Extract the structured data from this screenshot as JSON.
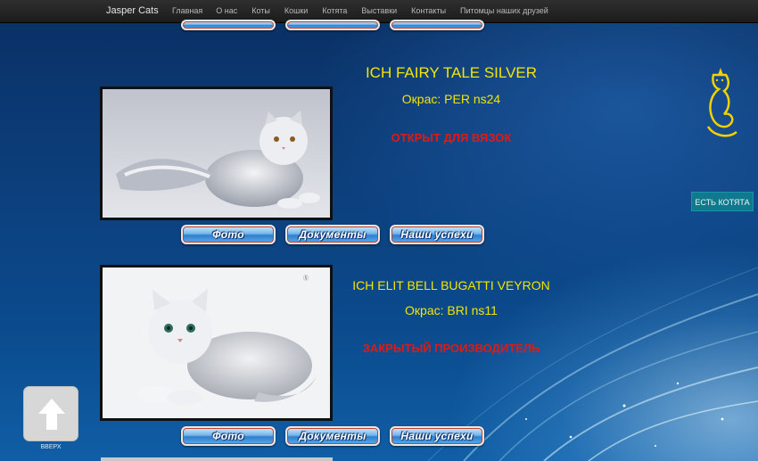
{
  "navbar": {
    "brand": "Jasper Cats",
    "items": [
      "Главная",
      "О нас",
      "Коты",
      "Кошки",
      "Котята",
      "Выставки",
      "Контакты",
      "Питомцы наших друзей"
    ]
  },
  "buttons": {
    "photo": "Фото",
    "documents": "Документы",
    "success": "Наши успехи"
  },
  "cats": [
    {
      "name": "ICH FAIRY TALE SILVER",
      "color": "Окрас: PER ns24",
      "status": "ОТКРЫТ ДЛЯ ВЯЗОК"
    },
    {
      "name": "ICH ELIT BELL BUGATTI VEYRON",
      "color": "Окрас: BRI ns11",
      "status": "ЗАКРЫТЫЙ ПРОИЗВОДИТЕЛЬ"
    }
  ],
  "side_button": "ЕСТЬ КОТЯТА",
  "scroll_up": "ВВЕРХ",
  "colors": {
    "title_yellow": "#f3e600",
    "status_red": "#e01a12",
    "side_button_bg": "#11798d"
  }
}
